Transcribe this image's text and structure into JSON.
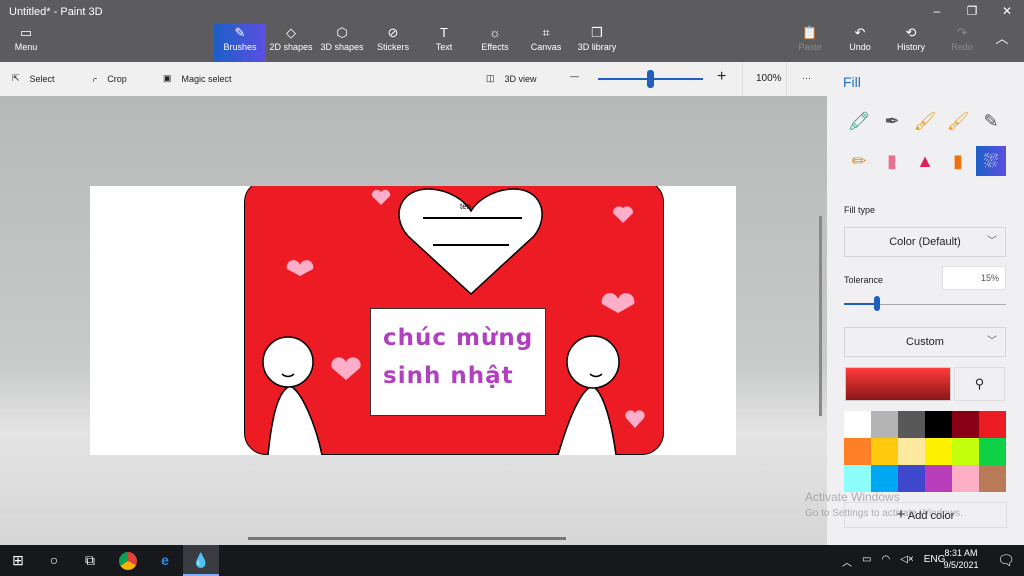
{
  "window": {
    "title": "Untitled* - Paint 3D",
    "minimize": "–",
    "restore": "❐",
    "close": "✕"
  },
  "ribbon": {
    "menu": {
      "icon": "folder-icon",
      "label": "Menu"
    },
    "tools": [
      {
        "label": "Brushes",
        "icon": "brush-icon",
        "glyph": "✎"
      },
      {
        "label": "2D shapes",
        "icon": "2d-shapes-icon",
        "glyph": "◇"
      },
      {
        "label": "3D shapes",
        "icon": "3d-shapes-icon",
        "glyph": "⬡"
      },
      {
        "label": "Stickers",
        "icon": "stickers-icon",
        "glyph": "⊘"
      },
      {
        "label": "Text",
        "icon": "text-icon",
        "glyph": "T"
      },
      {
        "label": "Effects",
        "icon": "effects-icon",
        "glyph": "☼"
      },
      {
        "label": "Canvas",
        "icon": "canvas-icon",
        "glyph": "⌗"
      },
      {
        "label": "3D library",
        "icon": "3d-library-icon",
        "glyph": "❒"
      }
    ],
    "active_tool": "Brushes",
    "paste": {
      "label": "Paste",
      "glyph": "📋"
    },
    "undo": {
      "label": "Undo",
      "glyph": "↶"
    },
    "history": {
      "label": "History",
      "glyph": "⟲"
    },
    "redo": {
      "label": "Redo",
      "glyph": "↷"
    },
    "collapse": "︿"
  },
  "toolbar": {
    "select": {
      "label": "Select",
      "glyph": "⇱"
    },
    "crop": {
      "label": "Crop",
      "glyph": "⌌"
    },
    "magic_select": {
      "label": "Magic select",
      "glyph": "▣"
    },
    "view3d": {
      "label": "3D view",
      "glyph": "◫"
    },
    "zoom_out": "—",
    "zoom_in": "+",
    "zoom_percent": "100%",
    "zoom_fraction": 0.5,
    "more": "···"
  },
  "canvas": {
    "heart_label": "tên",
    "greeting_line1": "chúc mừng",
    "greeting_line2": "sinh nhật",
    "card_color": "#ed1c24",
    "heart_color": "#ffaec9"
  },
  "panel": {
    "title": "Fill",
    "brushes": [
      {
        "name": "marker",
        "glyph": "🖍",
        "color": "#1a9a6a"
      },
      {
        "name": "calligraphy-pen",
        "glyph": "✒",
        "color": "#555"
      },
      {
        "name": "oil-brush",
        "glyph": "🖌",
        "color": "#e8a020"
      },
      {
        "name": "watercolor",
        "glyph": "🖌",
        "color": "#f0a030"
      },
      {
        "name": "pixel-pen",
        "glyph": "✎",
        "color": "#555"
      },
      {
        "name": "pencil",
        "glyph": "✏",
        "color": "#d09030"
      },
      {
        "name": "eraser",
        "glyph": "▮",
        "color": "#e87090"
      },
      {
        "name": "crayon",
        "glyph": "▲",
        "color": "#e0205a"
      },
      {
        "name": "spray-can",
        "glyph": "▮",
        "color": "#f07010"
      },
      {
        "name": "fill",
        "glyph": "⛆",
        "color": "#fff"
      }
    ],
    "fill_type_label": "Fill type",
    "fill_type_value": "Color (Default)",
    "tolerance_label": "Tolerance",
    "tolerance_value": "15%",
    "tolerance_fraction": 0.15,
    "color_mode": "Custom",
    "current_color": "#e02020",
    "palette": [
      "#ffffff",
      "#b4b4b4",
      "#585858",
      "#000000",
      "#880015",
      "#ed1c24",
      "#ff7f27",
      "#ffc90e",
      "#fde9a0",
      "#fff200",
      "#c4ff0e",
      "#0ed145",
      "#8cfffb",
      "#00a8f3",
      "#3f48cc",
      "#b83dba",
      "#ffaec8",
      "#b97a57"
    ],
    "add_color": "Add color"
  },
  "watermark": {
    "line1": "Activate Windows",
    "line2": "Go to Settings to activate Windows."
  },
  "taskbar": {
    "time": "8:31 AM",
    "date": "9/5/2021",
    "lang": "ENG"
  }
}
